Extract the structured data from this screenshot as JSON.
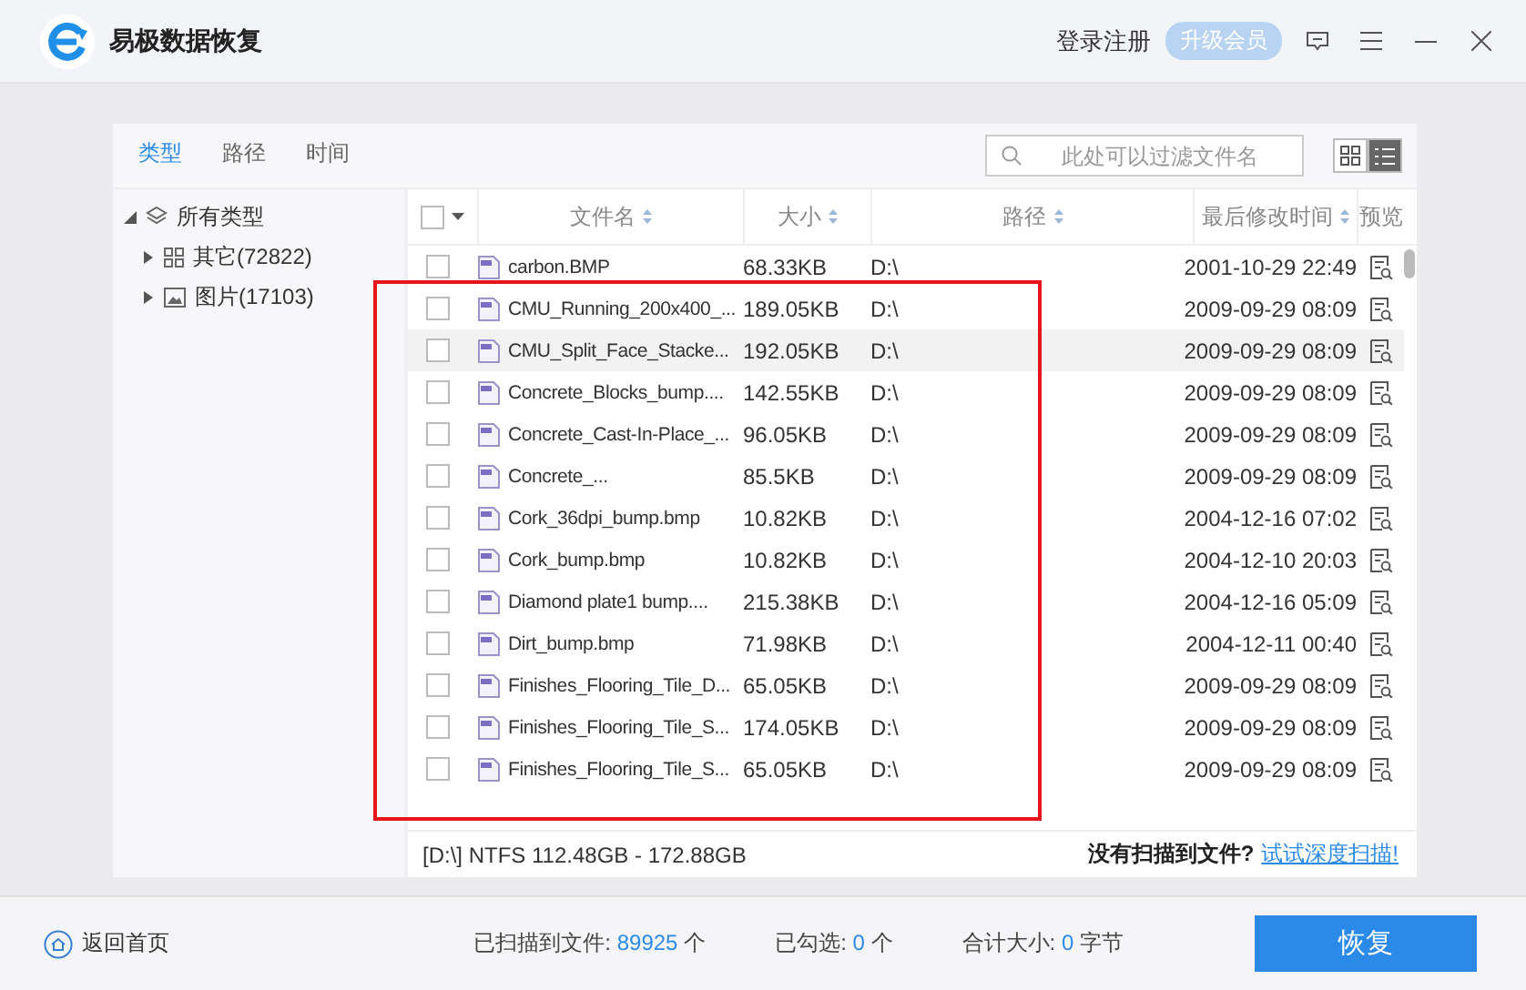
{
  "app": {
    "title": "易极数据恢复",
    "login": "登录注册",
    "upgrade": "升级会员"
  },
  "tabs": [
    {
      "label": "类型",
      "selected": true
    },
    {
      "label": "路径",
      "selected": false
    },
    {
      "label": "时间",
      "selected": false
    }
  ],
  "search": {
    "placeholder": "此处可以过滤文件名"
  },
  "view_modes": [
    {
      "kind": "grid",
      "selected": false
    },
    {
      "kind": "list",
      "selected": true
    }
  ],
  "sidebar": {
    "items": [
      {
        "label": "所有类型",
        "kind": "layers",
        "expanded": true,
        "children": [
          {
            "label": "其它(72822)",
            "kind": "other",
            "expanded": false
          },
          {
            "label": "图片(17103)",
            "kind": "image",
            "expanded": false
          }
        ]
      }
    ]
  },
  "table": {
    "select_all_checked": false,
    "columns": [
      {
        "label": "文件名",
        "sortable": true
      },
      {
        "label": "大小",
        "sortable": true
      },
      {
        "label": "路径",
        "sortable": true
      },
      {
        "label": "最后修改时间",
        "sortable": true
      },
      {
        "label": "预览",
        "sortable": false
      }
    ],
    "rows": [
      {
        "name": "carbon.BMP",
        "size": "68.33KB",
        "path": "D:\\",
        "modified": "2001-10-29 22:49",
        "checked": false,
        "selected": false
      },
      {
        "name": "CMU_Running_200x400_...",
        "size": "189.05KB",
        "path": "D:\\",
        "modified": "2009-09-29 08:09",
        "checked": false,
        "selected": false
      },
      {
        "name": "CMU_Split_Face_Stacke...",
        "size": "192.05KB",
        "path": "D:\\",
        "modified": "2009-09-29 08:09",
        "checked": false,
        "selected": true
      },
      {
        "name": "Concrete_Blocks_bump....",
        "size": "142.55KB",
        "path": "D:\\",
        "modified": "2009-09-29 08:09",
        "checked": false,
        "selected": false
      },
      {
        "name": "Concrete_Cast-In-Place_...",
        "size": "96.05KB",
        "path": "D:\\",
        "modified": "2009-09-29 08:09",
        "checked": false,
        "selected": false
      },
      {
        "name": "Concrete_...",
        "size": "85.5KB",
        "path": "D:\\",
        "modified": "2009-09-29 08:09",
        "checked": false,
        "selected": false
      },
      {
        "name": "Cork_36dpi_bump.bmp",
        "size": "10.82KB",
        "path": "D:\\",
        "modified": "2004-12-16 07:02",
        "checked": false,
        "selected": false
      },
      {
        "name": "Cork_bump.bmp",
        "size": "10.82KB",
        "path": "D:\\",
        "modified": "2004-12-10 20:03",
        "checked": false,
        "selected": false
      },
      {
        "name": "Diamond plate1 bump....",
        "size": "215.38KB",
        "path": "D:\\",
        "modified": "2004-12-16 05:09",
        "checked": false,
        "selected": false
      },
      {
        "name": "Dirt_bump.bmp",
        "size": "71.98KB",
        "path": "D:\\",
        "modified": "2004-12-11 00:40",
        "checked": false,
        "selected": false
      },
      {
        "name": "Finishes_Flooring_Tile_D...",
        "size": "65.05KB",
        "path": "D:\\",
        "modified": "2009-09-29 08:09",
        "checked": false,
        "selected": false
      },
      {
        "name": "Finishes_Flooring_Tile_S...",
        "size": "174.05KB",
        "path": "D:\\",
        "modified": "2009-09-29 08:09",
        "checked": false,
        "selected": false
      },
      {
        "name": "Finishes_Flooring_Tile_S...",
        "size": "65.05KB",
        "path": "D:\\",
        "modified": "2009-09-29 08:09",
        "checked": false,
        "selected": false
      }
    ]
  },
  "status_line": {
    "drive": "[D:\\] NTFS 112.48GB - 172.88GB",
    "prompt": "没有扫描到文件?",
    "link": "试试深度扫描!"
  },
  "footer": {
    "home": "返回首页",
    "stats": [
      {
        "label": "已扫描到文件:",
        "value": "89925",
        "unit": "个"
      },
      {
        "label": "已勾选:",
        "value": "0",
        "unit": "个"
      },
      {
        "label": "合计大小:",
        "value": "0",
        "unit": "字节"
      }
    ],
    "recover": "恢复"
  }
}
